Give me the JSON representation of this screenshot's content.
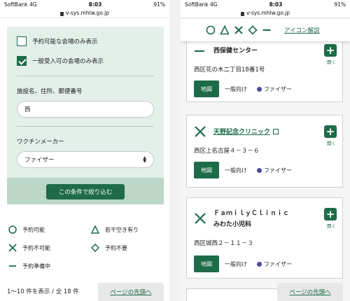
{
  "status": {
    "carrier": "SoftBank",
    "network": "4G",
    "time": "8:03",
    "battery": "91%"
  },
  "url": "v-sys.mhlw.go.jp",
  "filter": {
    "only_available_label": "予約可能な会場のみ表示",
    "only_available_checked": false,
    "only_general_label": "一般受入可の会場のみ表示",
    "only_general_checked": true,
    "search_label": "施設名、住所、郵便番号",
    "search_value": "西",
    "maker_label": "ワクチンメーカー",
    "maker_value": "ファイザー",
    "submit_label": "この条件で絞り込む"
  },
  "legend": [
    {
      "icon": "circle-icon",
      "label": "予約可能"
    },
    {
      "icon": "triangle-icon",
      "label": "若干空き有り"
    },
    {
      "icon": "cross-icon",
      "label": "予約不可能"
    },
    {
      "icon": "diamond-icon",
      "label": "予約不要"
    },
    {
      "icon": "dash-icon",
      "label": "予約準備中"
    }
  ],
  "result_count": "1～10 件を表示 / 全 18 件",
  "page_top_label": "ページの先頭へ",
  "icon_legend_link": "アイコン解説",
  "cards": [
    {
      "status_icon": "dash-icon",
      "name": "西保健センター",
      "is_link": false,
      "address": "西区花の木二丁目18番1号",
      "map_label": "地図",
      "target": "一般向け",
      "maker": "ファイザー",
      "open_label": "開く"
    },
    {
      "status_icon": "cross-icon",
      "name": "天野記念クリニック",
      "is_link": true,
      "address": "西区上名古屋４－３－６",
      "map_label": "地図",
      "target": "一般向け",
      "maker": "ファイザー",
      "open_label": "開く"
    },
    {
      "status_icon": "cross-icon",
      "name": "ＦａｍｉｌｙＣｌｉｎｉｃ",
      "name2": "みわた小児科",
      "is_link": false,
      "address": "西区城西２－１１－３",
      "map_label": "地図",
      "target": "一般向け",
      "maker": "ファイザー",
      "open_label": "開く"
    }
  ],
  "colors": {
    "accent": "#1e6b4a",
    "panel": "#e3efe9",
    "pfizer_dot": "#4b4ba0"
  }
}
